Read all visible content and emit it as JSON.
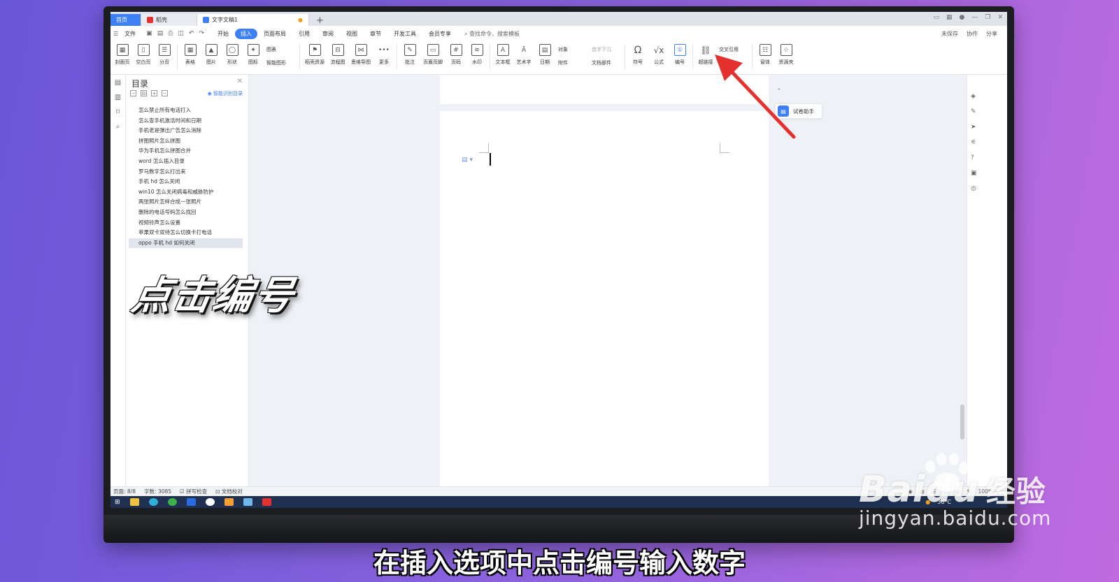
{
  "tabs": {
    "home": "首页",
    "drafts": "稻壳",
    "doc": "文字文稿1",
    "plus": "+"
  },
  "menubar": {
    "file": "文件",
    "items": [
      "开始",
      "插入",
      "页面布局",
      "引用",
      "审阅",
      "视图",
      "章节",
      "开发工具",
      "会员专享"
    ],
    "active_index": 1,
    "search": "查找命令、搜索模板",
    "right": [
      "未保存",
      "协作",
      "分享"
    ]
  },
  "ribbon": {
    "cover": "封面页",
    "blank": "空白页",
    "pagebreak": "分页",
    "table": "表格",
    "picture": "图片",
    "shape": "形状",
    "icon": "图标",
    "chart": "图表",
    "smartart": "智能图形",
    "resource": "稻壳资源",
    "flowchart": "流程图",
    "mindmap": "思维导图",
    "more": "更多",
    "comment": "批注",
    "headerfooter": "页眉页脚",
    "pagenum": "页码",
    "watermark": "水印",
    "textbox": "文本框",
    "wordart": "艺术字",
    "date": "日期",
    "object": "对象",
    "attachment": "附件",
    "dropcap": "首字下沉",
    "docpart": "文档部件",
    "symbol": "符号",
    "formula": "公式",
    "numbering": "编号",
    "hyperlink": "超链接",
    "crossref": "交叉引用",
    "bookmark": "书签",
    "font": "窗体",
    "assets": "资源夹"
  },
  "toc": {
    "title": "目录",
    "smart": "智能识别目录",
    "items": [
      "怎么禁止所有电话打入",
      "怎么查手机激活时间和日期",
      "手机老是弹出广告怎么消除",
      "拼图照片怎么拼图",
      "华为手机怎么拼图合并",
      "word 怎么插入目录",
      "罗马数字怎么打出来",
      "手机 hd 怎么关闭",
      "win10 怎么关闭病毒和威胁防护",
      "两张照片怎样合成一张照片",
      "删除的电话号码怎么找回",
      "视频铃声怎么设置",
      "苹果双卡双待怎么切换卡打电话",
      "oppo 手机 hd 如何关闭"
    ],
    "selected_index": 13
  },
  "assistant": "试卷助手",
  "status": {
    "page": "页面: 8/8",
    "words": "字数: 3085",
    "spell": "拼写检查",
    "proof": "文档校对",
    "zoom": "100%"
  },
  "taskbar": {
    "temp": "36°C"
  },
  "overlay": "点击编号",
  "caption": "在插入选项中点击编号输入数字",
  "watermark": {
    "brand": "Bai",
    "brand2": "du",
    "cn": "经验",
    "url": "jingyan.baidu.com"
  },
  "colors": {
    "accent": "#3d7ff5",
    "arrow": "#e5312e"
  }
}
